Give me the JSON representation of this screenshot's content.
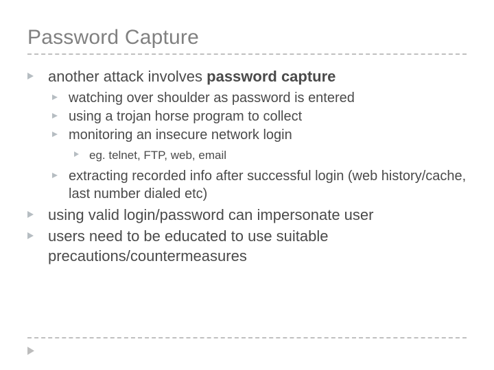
{
  "title": "Password Capture",
  "bullets": {
    "b0_prefix": "another attack involves ",
    "b0_bold": "password capture",
    "b0_sub": [
      "watching over shoulder as password is entered",
      "using a trojan horse program to collect",
      "monitoring an insecure network login"
    ],
    "b0_sub_sub": "eg. telnet, FTP, web, email",
    "b0_sub3": "extracting recorded info after successful login (web history/cache, last number dialed etc)",
    "b1": "using valid login/password can impersonate user",
    "b2": "users need to be educated to use suitable precautions/countermeasures"
  }
}
